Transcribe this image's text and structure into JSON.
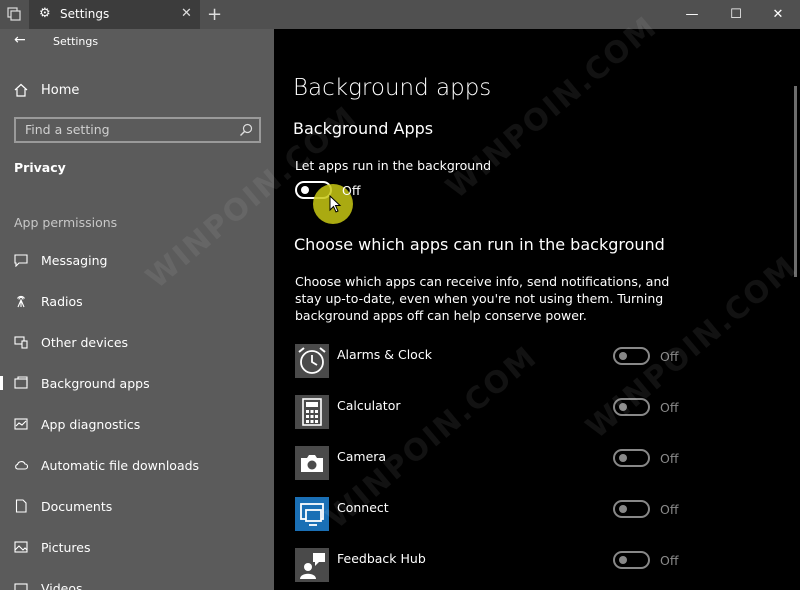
{
  "window": {
    "tab_title": "Settings",
    "new_tab": "+",
    "minimize": "—",
    "maximize": "☐",
    "close": "✕",
    "tab_close": "✕"
  },
  "sidebar": {
    "app_title": "Settings",
    "home_label": "Home",
    "search_placeholder": "Find a setting",
    "section": "Privacy",
    "group": "App permissions",
    "items": [
      {
        "label": "Messaging",
        "icon": "messaging-icon"
      },
      {
        "label": "Radios",
        "icon": "radios-icon"
      },
      {
        "label": "Other devices",
        "icon": "other-devices-icon"
      },
      {
        "label": "Background apps",
        "icon": "background-apps-icon",
        "selected": true
      },
      {
        "label": "App diagnostics",
        "icon": "app-diagnostics-icon"
      },
      {
        "label": "Automatic file downloads",
        "icon": "cloud-icon"
      },
      {
        "label": "Documents",
        "icon": "document-icon"
      },
      {
        "label": "Pictures",
        "icon": "picture-icon"
      },
      {
        "label": "Videos",
        "icon": "video-icon"
      }
    ]
  },
  "main": {
    "title": "Background apps",
    "subtitle": "Background Apps",
    "toggle_label": "Let apps run in the background",
    "toggle_state": "Off",
    "section_title": "Choose which apps can run in the background",
    "description": "Choose which apps can receive info, send notifications, and stay up-to-date, even when you're not using them. Turning background apps off can help conserve power.",
    "apps": [
      {
        "name": "Alarms & Clock",
        "state": "Off",
        "icon": "alarm-clock-icon"
      },
      {
        "name": "Calculator",
        "state": "Off",
        "icon": "calculator-icon"
      },
      {
        "name": "Camera",
        "state": "Off",
        "icon": "camera-icon"
      },
      {
        "name": "Connect",
        "state": "Off",
        "icon": "connect-icon"
      },
      {
        "name": "Feedback Hub",
        "state": "Off",
        "icon": "feedback-hub-icon"
      }
    ]
  },
  "watermark": "WINPOIN.COM",
  "colors": {
    "sidebar_bg": "#5b5b5b",
    "main_bg": "#000000",
    "titlebar_bg": "#505050",
    "connect_icon_bg": "#1a6fb5",
    "cursor_highlight": "#c8c814"
  }
}
